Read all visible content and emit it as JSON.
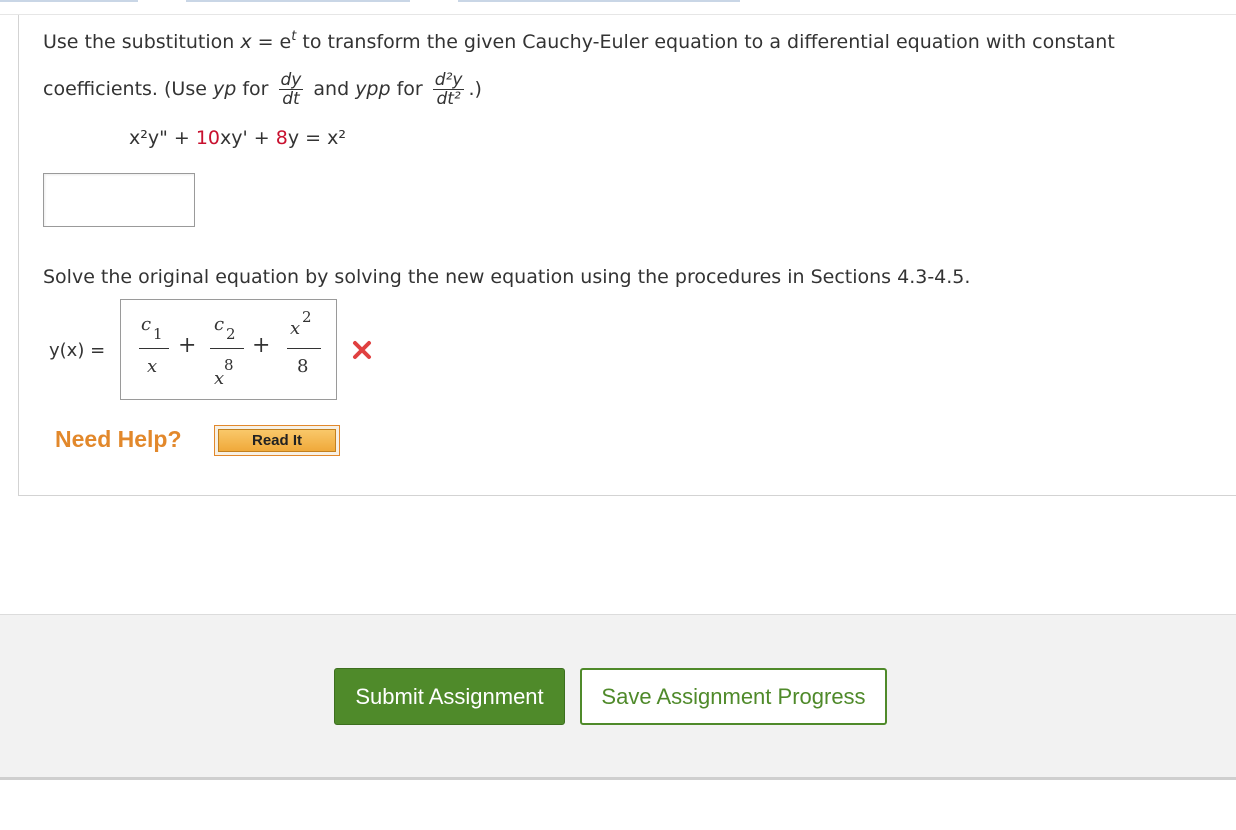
{
  "prompt": {
    "part1": "Use the substitution ",
    "sub_x": "x",
    "sub_eq": " = e",
    "sub_t": "t",
    "part2": " to transform the given Cauchy-Euler equation to a differential equation with constant",
    "line2_a": "coefficients. (Use ",
    "yp": "yp",
    "for1": " for ",
    "dy": "dy",
    "dt": "dt",
    "and": " and ",
    "ypp": "ypp",
    "for2": " for ",
    "d2y": "d²y",
    "dt2": "dt²",
    "close": ".)"
  },
  "equation": {
    "a": "x²y\" + ",
    "c1": "10",
    "b": "xy' + ",
    "c2": "8",
    "c": "y = x²"
  },
  "answer1": {
    "value": ""
  },
  "solve_text": "Solve the original equation by solving the new equation using the procedures in Sections 4.3-4.5.",
  "answer2": {
    "label": "y(x) =",
    "t1_num": "c",
    "t1_num_sub": "1",
    "t1_den": "x",
    "plus1": "+",
    "t2_num": "c",
    "t2_num_sub": "2",
    "t2_den": "x",
    "t2_den_sup": "8",
    "plus2": "+",
    "t3_num": "x",
    "t3_num_sup": "2",
    "t3_den": "8",
    "status": "incorrect"
  },
  "help": {
    "need_help": "Need Help?",
    "read_it": "Read It"
  },
  "footer": {
    "submit": "Submit Assignment",
    "save": "Save Assignment Progress"
  },
  "colors": {
    "accent_green": "#4f8a2a",
    "help_orange": "#e2882b",
    "error_red": "#e04040",
    "coef_red": "#c8102e"
  }
}
